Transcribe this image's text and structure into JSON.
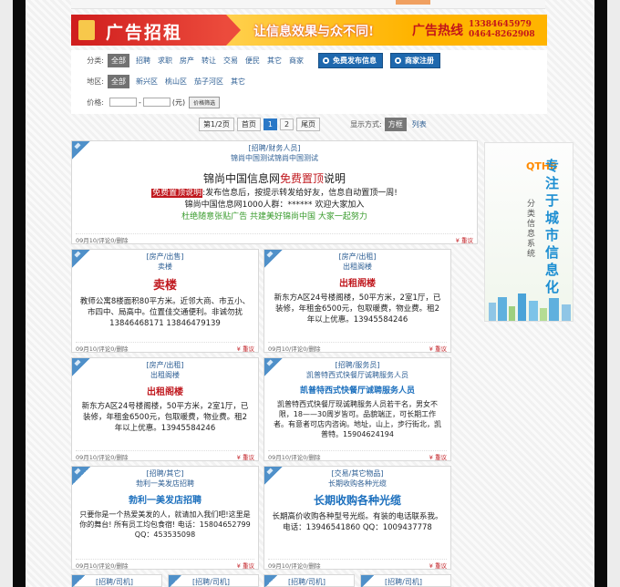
{
  "banner": {
    "left_text": "广告招租",
    "slogan": "让信息效果与众不同!",
    "hotline_label": "广告热线",
    "phone1": "13384645979",
    "phone2": "0464-8262908"
  },
  "filter": {
    "category_label": "分类:",
    "categories": [
      "全部",
      "招聘",
      "求职",
      "房产",
      "转让",
      "交易",
      "便民",
      "其它",
      "商家"
    ],
    "publish_button": "免费发布信息",
    "merchant_button": "商家注册",
    "area_label": "地区:",
    "areas": [
      "全部",
      "新兴区",
      "桃山区",
      "茄子河区",
      "其它"
    ],
    "price_label": "价格:",
    "price_dash": "-",
    "price_unit": "(元)",
    "price_button": "价格筛选"
  },
  "pager": {
    "page_info": "第1/2页",
    "first": "首页",
    "p1": "1",
    "p2": "2",
    "last": "尾页",
    "mode_label": "显示方式:",
    "mode_grid": "方框",
    "mode_list": "列表"
  },
  "featured": {
    "cat": "[招聘/财务人员]",
    "sub": "锦尚中国测试锦尚中国测试",
    "title_prefix": "锦尚中国信息网",
    "title_red": "免费置顶",
    "title_suffix": "说明",
    "line1_tag": "免费置顶说明",
    "line1": ":发布信息后，按提示转发给好友，信息自动置顶一周!",
    "line2": "锦尚中国信息网1000人群：****** 欢迎大家加入",
    "line3": "杜绝随意张贴广告 共建美好锦尚中国 大家一起努力",
    "meta": "09月10/评论0/删除",
    "report": "¥ 重议"
  },
  "cards": [
    {
      "cat": "[房产/出售]",
      "sub": "卖楼",
      "headline": "卖楼",
      "body": "教师公寓8楼面积80平方米。近邻大商、市五小、市四中、局高中。位置佳交通便利。非诚勿扰 13846468171 13846479139",
      "meta": "09月10/评论0/删除",
      "report": "¥ 重议"
    },
    {
      "cat": "[房产/出租]",
      "sub": "出租阁楼",
      "headline": "出租阁楼",
      "body": "新东方A区24号楼阁楼，50平方米，2室1厅，已装修，年租金6500元，包取暖费，物业费。租2年以上优惠。13945584246",
      "meta": "09月10/评论0/删除",
      "report": "¥ 重议"
    },
    {
      "cat": "[房产/出租]",
      "sub": "出租阁楼",
      "headline": "出租阁楼",
      "body": "新东方A区24号楼阁楼，50平方米，2室1厅，已装修，年租金6500元，包取暖费，物业费。租2年以上优惠。13945584246",
      "meta": "09月10/评论0/删除",
      "report": "¥ 重议"
    },
    {
      "cat": "[招聘/服务员]",
      "sub": "凯普特西式快餐厅诚聘服务人员",
      "headline": "凯普特西式快餐厅诚聘服务人员",
      "body": "凯普特西式快餐厅现诚聘服务人员若干名，男女不限，18——30周岁皆可。品貌端正，可长期工作者。有意者可店内咨询。地址，山上，步行街北，凯普特。15904624194",
      "meta": "09月10/评论0/删除",
      "report": "¥ 重议"
    },
    {
      "cat": "[招聘/其它]",
      "sub": "勃利一美发店招聘",
      "headline": "勃利一美发店招聘",
      "body": "只要你是一个热爱美发的人，就请加入我们吧!这里是你的舞台! 所有员工均包食宿! 电话：15804652799 QQ：453535098",
      "meta": "09月10/评论0/删除",
      "report": "¥ 重议"
    },
    {
      "cat": "[交易/其它物品]",
      "sub": "长期收购各种光缆",
      "headline": "长期收购各种光缆",
      "body": "长期高价收购各种型号光缆。有装的电话联系我。电话：13946541860 QQ：1009437778",
      "meta": "09月10/评论0/删除",
      "report": "¥ 重议"
    }
  ],
  "mini_cards": [
    "[招聘/司机]",
    "[招聘/司机]",
    "[招聘/司机]",
    "[招聘/司机]"
  ],
  "sidebar_ad": {
    "brand": "QTHB",
    "sub": "分类信息系统",
    "slogan": "专注于城市信息化"
  }
}
